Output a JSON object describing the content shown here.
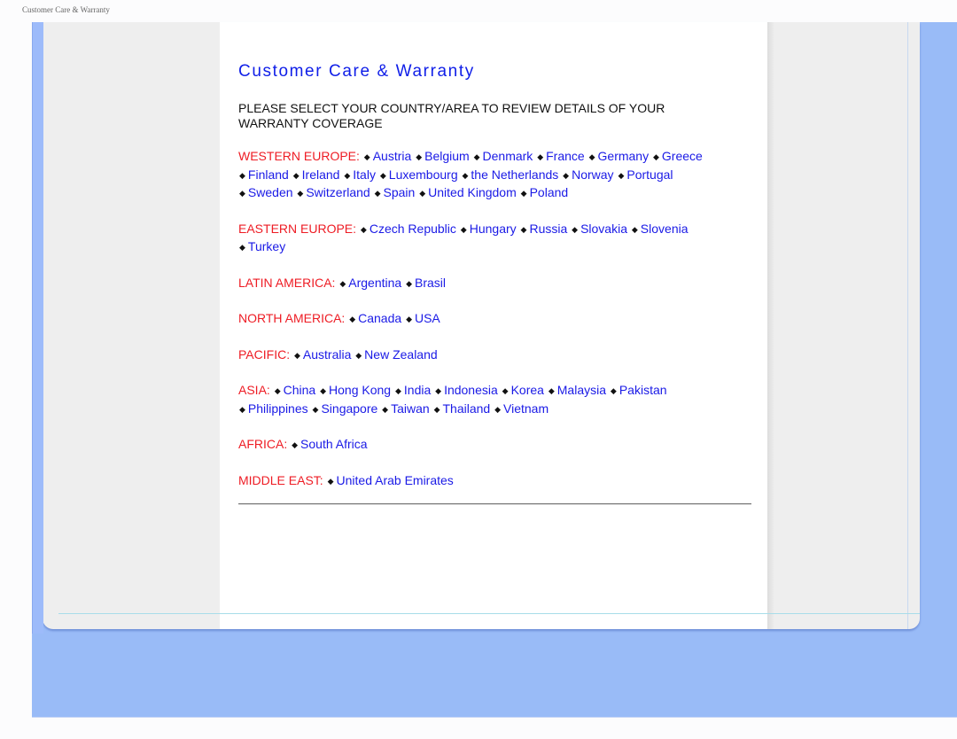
{
  "window": {
    "caption": "Customer Care & Warranty"
  },
  "page": {
    "title": "Customer Care & Warranty",
    "intro": "PLEASE SELECT YOUR COUNTRY/AREA TO REVIEW DETAILS OF YOUR WARRANTY COVERAGE",
    "bullet": "◆",
    "colors": {
      "title": "#0f1ee8",
      "region_label": "#ee1c24",
      "link": "#1a1ae6",
      "frame_blue": "#99bbf7"
    },
    "regions": [
      {
        "label": "WESTERN EUROPE:",
        "countries": [
          "Austria",
          "Belgium",
          "Denmark",
          "France",
          "Germany",
          "Greece",
          "Finland",
          "Ireland",
          "Italy",
          "Luxembourg",
          "the Netherlands",
          "Norway",
          "Portugal",
          "Sweden",
          "Switzerland",
          "Spain",
          "United Kingdom",
          "Poland"
        ]
      },
      {
        "label": "EASTERN EUROPE:",
        "countries": [
          "Czech Republic",
          "Hungary",
          "Russia",
          "Slovakia",
          "Slovenia",
          "Turkey"
        ]
      },
      {
        "label": "LATIN AMERICA:",
        "countries": [
          "Argentina",
          "Brasil"
        ]
      },
      {
        "label": "NORTH AMERICA:",
        "countries": [
          "Canada",
          "USA"
        ]
      },
      {
        "label": "PACIFIC:",
        "countries": [
          "Australia",
          "New Zealand"
        ]
      },
      {
        "label": "ASIA:",
        "countries": [
          "China",
          "Hong Kong",
          "India",
          "Indonesia",
          "Korea",
          "Malaysia",
          "Pakistan",
          "Philippines",
          "Singapore",
          "Taiwan",
          "Thailand",
          "Vietnam"
        ]
      },
      {
        "label": "AFRICA:",
        "countries": [
          "South Africa"
        ]
      },
      {
        "label": "MIDDLE EAST:",
        "countries": [
          "United Arab Emirates"
        ]
      }
    ]
  }
}
